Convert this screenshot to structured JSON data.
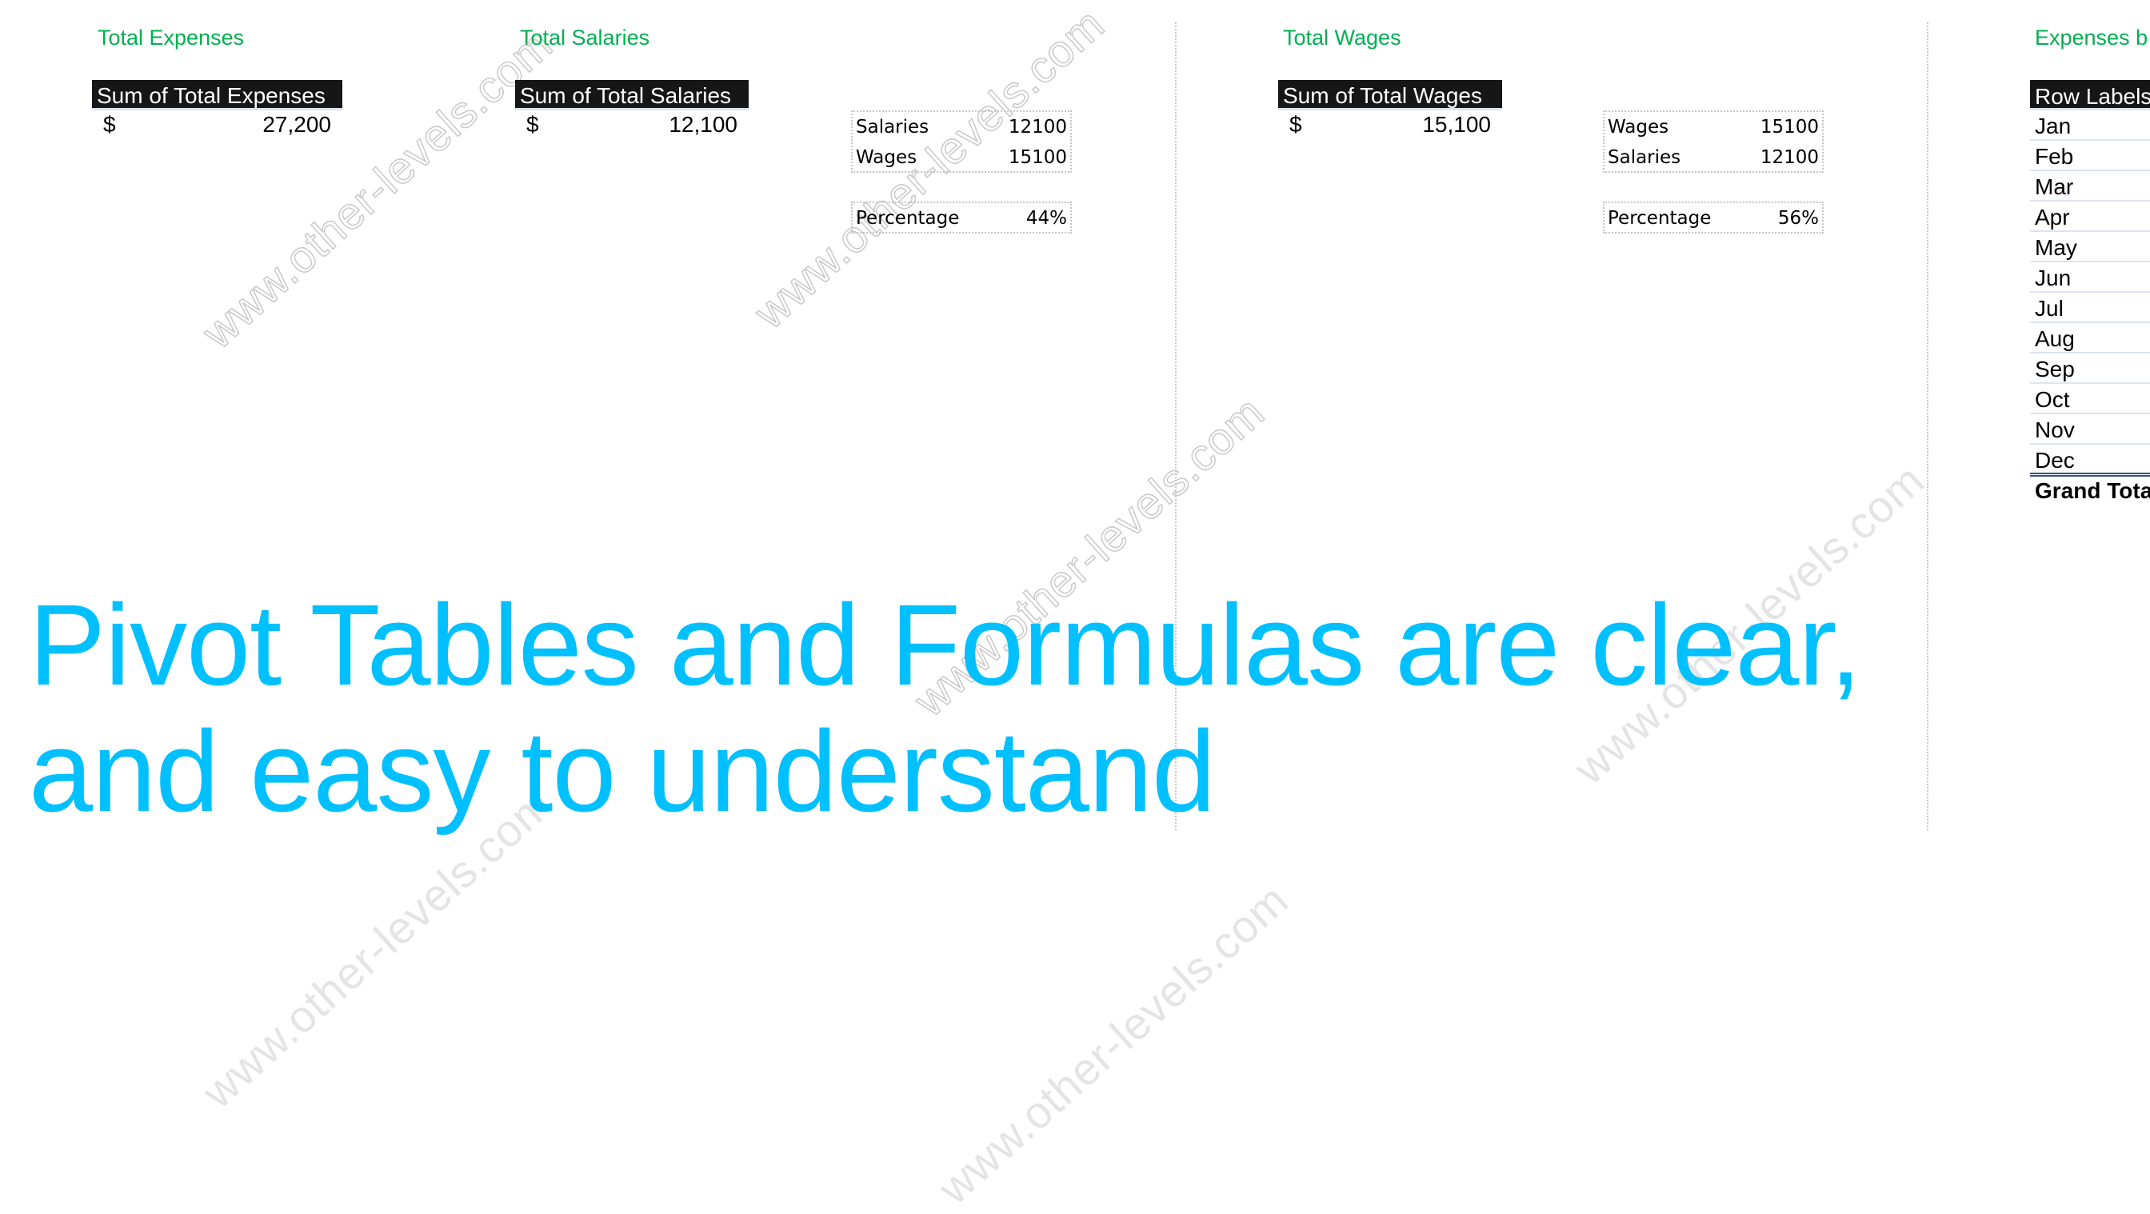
{
  "sections": {
    "expenses": {
      "title": "Total Expenses",
      "pivot_header": "Sum of Total Expenses",
      "currency": "$",
      "value": "27,200"
    },
    "salaries": {
      "title": "Total Salaries",
      "pivot_header": "Sum of Total Salaries",
      "currency": "$",
      "value": "12,100",
      "calc": {
        "rows": [
          {
            "label": "Salaries",
            "value": "12100"
          },
          {
            "label": "Wages",
            "value": "15100"
          }
        ],
        "percentage_label": "Percentage",
        "percentage_value": "44%"
      }
    },
    "wages": {
      "title": "Total Wages",
      "pivot_header": "Sum of Total Wages",
      "currency": "$",
      "value": "15,100",
      "calc": {
        "rows": [
          {
            "label": "Wages",
            "value": "15100"
          },
          {
            "label": "Salaries",
            "value": "12100"
          }
        ],
        "percentage_label": "Percentage",
        "percentage_value": "56%"
      }
    },
    "by_month": {
      "title": "Expenses b",
      "header": "Row Labels",
      "months": [
        "Jan",
        "Feb",
        "Mar",
        "Apr",
        "May",
        "Jun",
        "Jul",
        "Aug",
        "Sep",
        "Oct",
        "Nov",
        "Dec"
      ],
      "total_label": "Grand Tota"
    }
  },
  "headline": {
    "line1": "Pivot Tables and Formulas are clear,",
    "line2": "and easy to understand"
  },
  "watermark": "www.other-levels.com",
  "colors": {
    "title_green": "#00B050",
    "headline_cyan": "#00C0FF",
    "pivot_header_bg": "#161616",
    "total_rule_blue": "#2F4F8F"
  }
}
